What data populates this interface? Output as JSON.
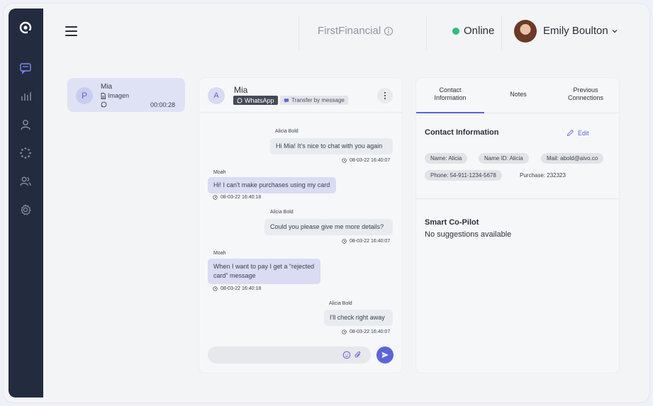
{
  "nav": {
    "logo": "brand-logo-icon",
    "items": [
      {
        "icon": "chat-icon",
        "active": true
      },
      {
        "icon": "bar-chart-icon",
        "active": false
      },
      {
        "icon": "user-icon",
        "active": false
      },
      {
        "icon": "loading-dots-icon",
        "active": false
      },
      {
        "icon": "users-icon",
        "active": false
      },
      {
        "icon": "settings-icon",
        "active": false
      }
    ]
  },
  "header": {
    "brand": "FirstFinancial",
    "status": "Online",
    "user_name": "Emily Boulton"
  },
  "conversation_list": [
    {
      "initial": "P",
      "name": "Mia",
      "subtitle": "Imagen",
      "timer": "00:00:28"
    }
  ],
  "chat": {
    "initial": "A",
    "contact_name": "Mia",
    "channel_tag": "WhatsApp",
    "transfer_tag": "Transfer by message",
    "messages": [
      {
        "sender": "Alicia Bold",
        "text": "Hi Mia! It's nice to chat with you again",
        "time": "08-03-22 16:40:07",
        "direction": "out"
      },
      {
        "sender": "Moah",
        "text": "Hi! I can't make purchases using my card",
        "time": "08-03-22 16:40:18",
        "direction": "in"
      },
      {
        "sender": "Alicia Bold",
        "text": "Could you please give me more details?",
        "time": "08-03-22 16:40:07",
        "direction": "out"
      },
      {
        "sender": "Moah",
        "text": "When I want to pay I get a “rejected card” message",
        "time": "08-03-22 16:40:18",
        "direction": "in"
      },
      {
        "sender": "Alicia Bold",
        "text": "I'll check right away",
        "time": "08-03-22 16:40:07",
        "direction": "out"
      }
    ],
    "composer_placeholder": ""
  },
  "details": {
    "tabs": [
      "Contact Information",
      "Notes",
      "Previous Connections"
    ],
    "active_tab": 0,
    "contact_title": "Contact Information",
    "edit_label": "Edit",
    "chips": {
      "name": "Name: Alicia",
      "name_id": "Name ID: Alicia",
      "mail": "Mail: abold@aivo.co",
      "phone": "Phone: 54-911-1234-5678",
      "purchase": "Purchase: 232323"
    },
    "copilot_title": "Smart Co-Pilot",
    "copilot_text": "No suggestions available"
  },
  "colors": {
    "sidebar": "#232c3f",
    "accent": "#5b66d6",
    "online": "#2ebd7e",
    "incoming_bubble": "#d9dcf3",
    "outgoing_bubble": "#e8ebf0"
  }
}
